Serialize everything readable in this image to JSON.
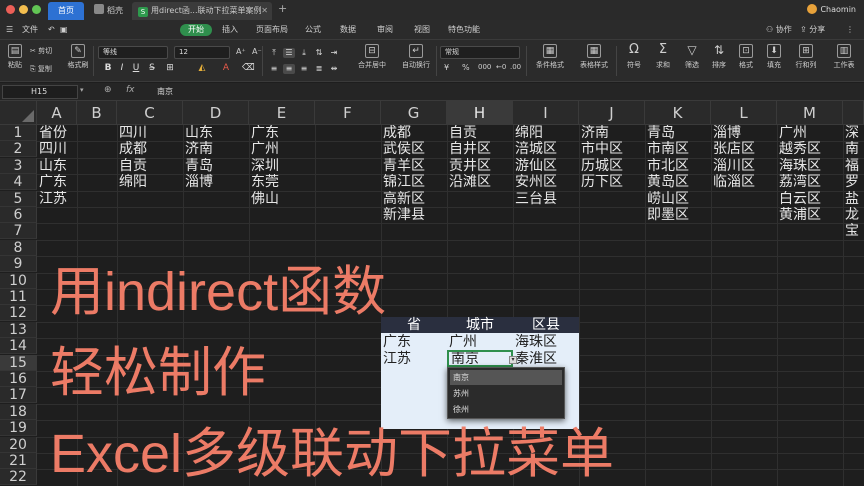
{
  "tabs": {
    "home": "首页",
    "doc1": "稻壳",
    "doc2": "用direct函...联动下拉菜单案例",
    "doc2_icon": "S"
  },
  "user": {
    "name": "Chaomin"
  },
  "menu": {
    "file": "文件",
    "start": "开始",
    "items": [
      "插入",
      "页面布局",
      "公式",
      "数据",
      "审阅",
      "视图",
      "特色功能"
    ],
    "collab": "协作",
    "share": "分享"
  },
  "toolbar": {
    "paste": "粘贴",
    "cut": "剪切",
    "copy": "复制",
    "format_painter": "格式刷",
    "font_name": "等线",
    "font_size": "12",
    "bold": "B",
    "italic": "I",
    "underline": "U",
    "merge_center": "合并居中",
    "wrap_text": "自动换行",
    "number_format": "常规",
    "currency": "¥",
    "percent": "%",
    "conditional_format": "条件格式",
    "table_style": "表格样式",
    "symbol": "符号",
    "sum": "求和",
    "filter": "筛选",
    "sort": "排序",
    "format": "格式",
    "fill": "填充",
    "row_col": "行和列",
    "worksheet": "工作表"
  },
  "formula_bar": {
    "name_box": "H15",
    "fx": "fx",
    "value": "南京"
  },
  "columns": [
    "A",
    "B",
    "C",
    "D",
    "E",
    "F",
    "G",
    "H",
    "I",
    "J",
    "K",
    "L",
    "M"
  ],
  "selected_column": "H",
  "rows": [
    "1",
    "2",
    "3",
    "4",
    "5",
    "6",
    "7",
    "8",
    "9",
    "10",
    "11",
    "12",
    "13",
    "14",
    "15",
    "16",
    "17",
    "18",
    "19",
    "20",
    "21",
    "22"
  ],
  "selected_row": "15",
  "sheet": {
    "A": [
      "省份",
      "四川",
      "山东",
      "广东",
      "江苏"
    ],
    "C": [
      "四川",
      "成都",
      "自贡",
      "绵阳"
    ],
    "D": [
      "山东",
      "济南",
      "青岛",
      "淄博"
    ],
    "E": [
      "广东",
      "广州",
      "深圳",
      "东莞",
      "佛山"
    ],
    "G": [
      "成都",
      "武侯区",
      "青羊区",
      "锦江区",
      "高新区",
      "新津县"
    ],
    "H": [
      "自贡",
      "自井区",
      "贡井区",
      "沿滩区"
    ],
    "I": [
      "绵阳",
      "涪城区",
      "游仙区",
      "安州区",
      "三台县"
    ],
    "J": [
      "济南",
      "市中区",
      "历城区",
      "历下区"
    ],
    "K": [
      "青岛",
      "市南区",
      "市北区",
      "黄岛区",
      "崂山区",
      "即墨区"
    ],
    "L": [
      "淄博",
      "张店区",
      "淄川区",
      "临淄区"
    ],
    "M": [
      "广州",
      "越秀区",
      "海珠区",
      "荔湾区",
      "白云区",
      "黄浦区"
    ],
    "N": [
      "深",
      "南",
      "福",
      "罗",
      "盐",
      "龙",
      "宝"
    ]
  },
  "mini_table": {
    "headers": [
      "省",
      "城市",
      "区县"
    ],
    "rows": [
      [
        "广东",
        "广州",
        "海珠区"
      ],
      [
        "江苏",
        "南京",
        "秦淮区"
      ]
    ]
  },
  "dropdown": {
    "items": [
      "南京",
      "苏州",
      "徐州"
    ],
    "active_index": 0
  },
  "captions": {
    "line1": "用indirect函数",
    "line2": "轻松制作",
    "line3": "Excel多级联动下拉菜单"
  },
  "colors": {
    "accent_green": "#2f8f4d",
    "tab_blue": "#2d71d3",
    "caption_orange": "#ec7b66",
    "table_header": "#2a2f3f",
    "table_fill": "#e4eef9"
  }
}
